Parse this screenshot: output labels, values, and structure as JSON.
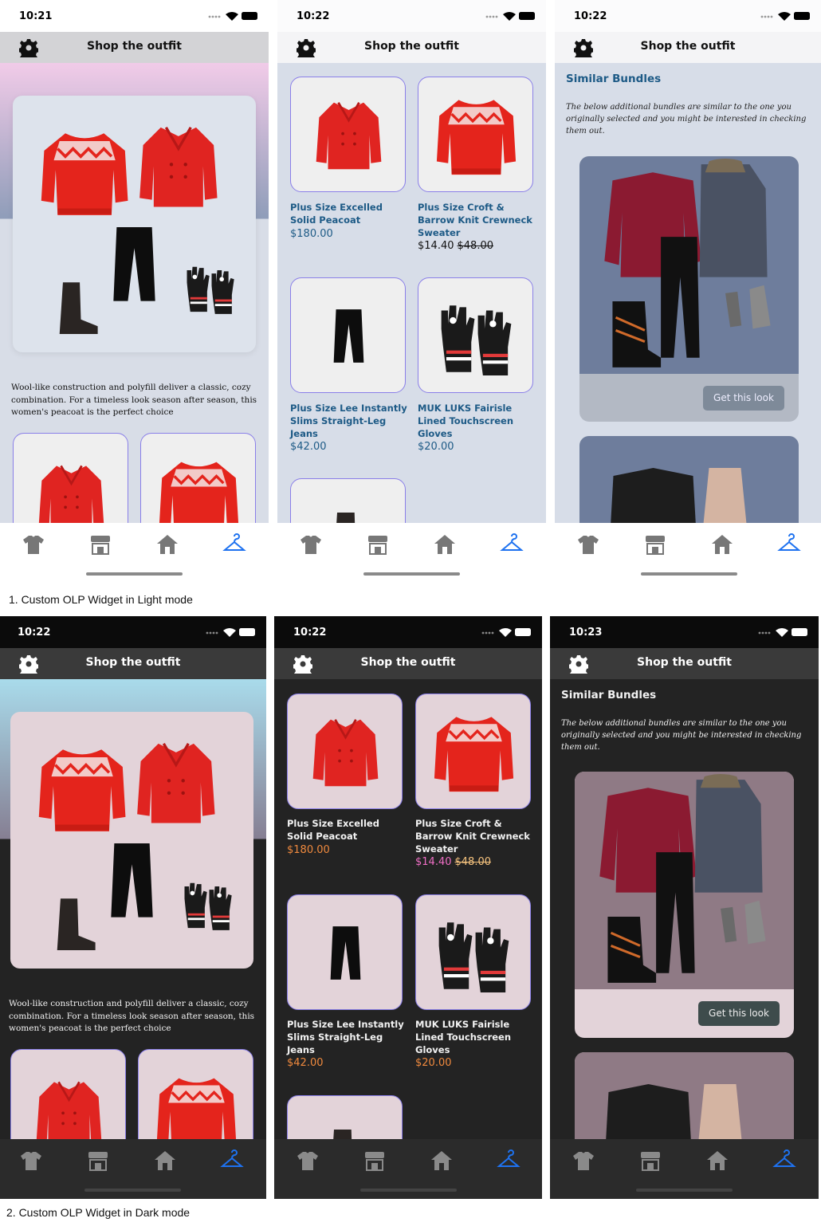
{
  "nav": {
    "title": "Shop the outfit"
  },
  "status_times": {
    "l1": "10:21",
    "l2": "10:22",
    "l3": "10:22",
    "d1": "10:22",
    "d2": "10:22",
    "d3": "10:23"
  },
  "outfit": {
    "description": "Wool-like construction and polyfill deliver a classic, cozy combination. For a timeless look season after season, this women's peacoat is the perfect choice"
  },
  "products": [
    {
      "name": "Plus Size Excelled Solid Peacoat",
      "price": "$180.00"
    },
    {
      "name": "Plus Size Croft & Barrow Knit Crewneck Sweater",
      "price": "$14.40",
      "original_price": "$48.00"
    },
    {
      "name": "Plus Size Lee Instantly Slims Straight-Leg Jeans",
      "price": "$42.00"
    },
    {
      "name": "MUK LUKS Fairisle Lined Touchscreen Gloves",
      "price": "$20.00"
    }
  ],
  "similar": {
    "title": "Similar Bundles",
    "text": "The below additional bundles are similar to the one you originally selected and you might be interested in checking them out.",
    "button": "Get this look"
  },
  "tabs": [
    "shirt-icon",
    "store-icon",
    "home-icon",
    "hanger-icon"
  ],
  "captions": {
    "light": "1. Custom OLP Widget in Light mode",
    "dark": "2. Custom OLP Widget in Dark mode"
  },
  "colors": {
    "accent_blue": "#1e72f0",
    "light_link": "#1d5a86",
    "dark_price": "#f08a3e",
    "sale_pink": "#ef6ec5"
  }
}
